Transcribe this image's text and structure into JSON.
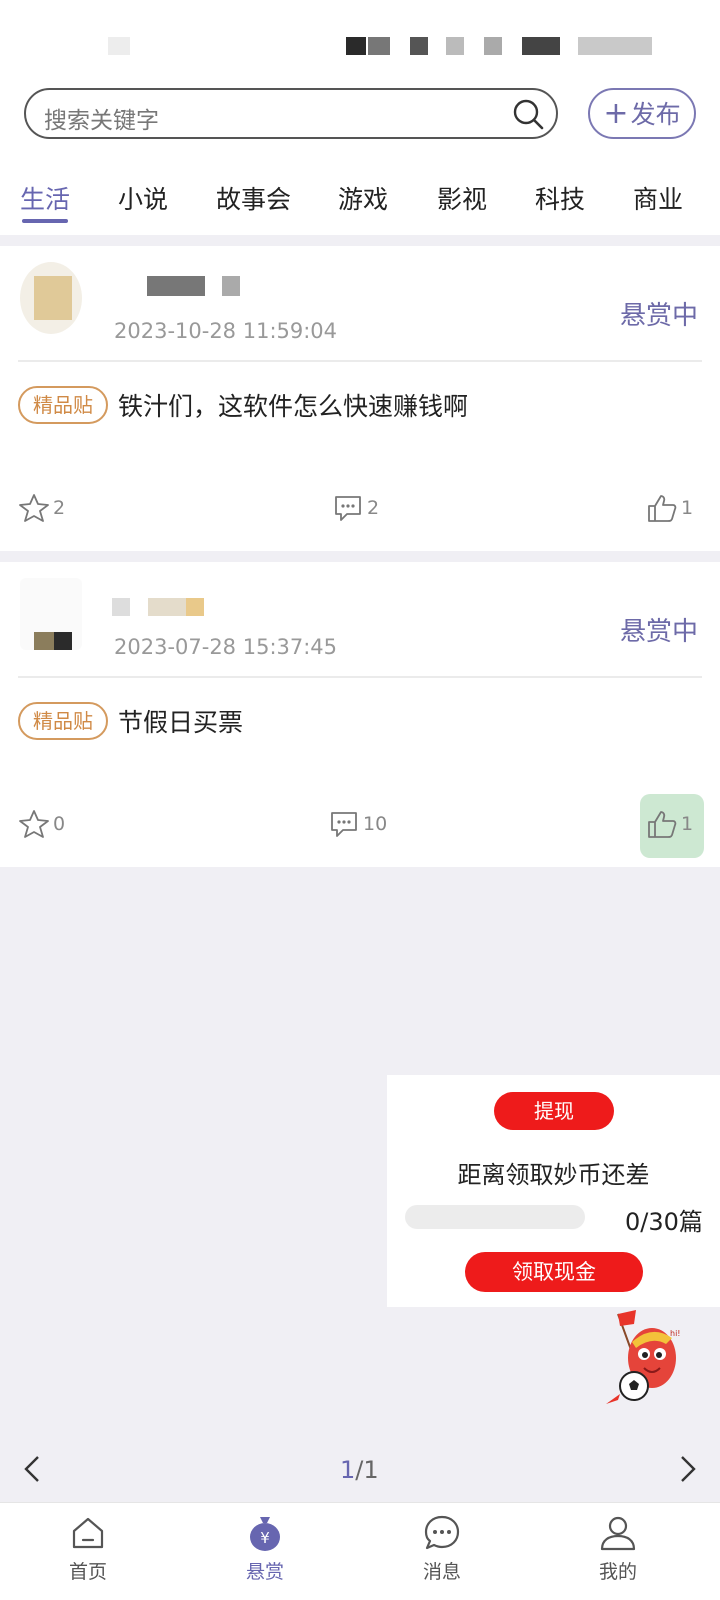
{
  "search": {
    "placeholder": "搜索关键字"
  },
  "header": {
    "publish_label": "发布"
  },
  "tabs": [
    {
      "label": "生活",
      "active": true
    },
    {
      "label": "小说"
    },
    {
      "label": "故事会"
    },
    {
      "label": "游戏"
    },
    {
      "label": "影视"
    },
    {
      "label": "科技"
    },
    {
      "label": "商业"
    }
  ],
  "posts": [
    {
      "date": "2023-10-28 11:59:04",
      "status": "悬赏中",
      "badge": "精品贴",
      "title": "铁汁们，这软件怎么快速赚钱啊",
      "favorites": "2",
      "comments": "2",
      "likes": "1"
    },
    {
      "date": "2023-07-28 15:37:45",
      "status": "悬赏中",
      "badge": "精品贴",
      "title": "节假日买票",
      "favorites": "0",
      "comments": "10",
      "likes": "1"
    }
  ],
  "cash_widget": {
    "withdraw_label": "提现",
    "text": "距离领取妙币还差",
    "progress_text": "0/30篇",
    "progress_value": 0,
    "claim_label": "领取现金"
  },
  "pager": {
    "current": "1",
    "total": "/1"
  },
  "bottom_nav": [
    {
      "label": "首页",
      "icon": "home-icon"
    },
    {
      "label": "悬赏",
      "icon": "money-bag-icon",
      "active": true
    },
    {
      "label": "消息",
      "icon": "chat-icon"
    },
    {
      "label": "我的",
      "icon": "user-icon"
    }
  ],
  "colors": {
    "accent": "#6766b0",
    "badge": "#d08a46",
    "cta": "#ee1b1b"
  }
}
